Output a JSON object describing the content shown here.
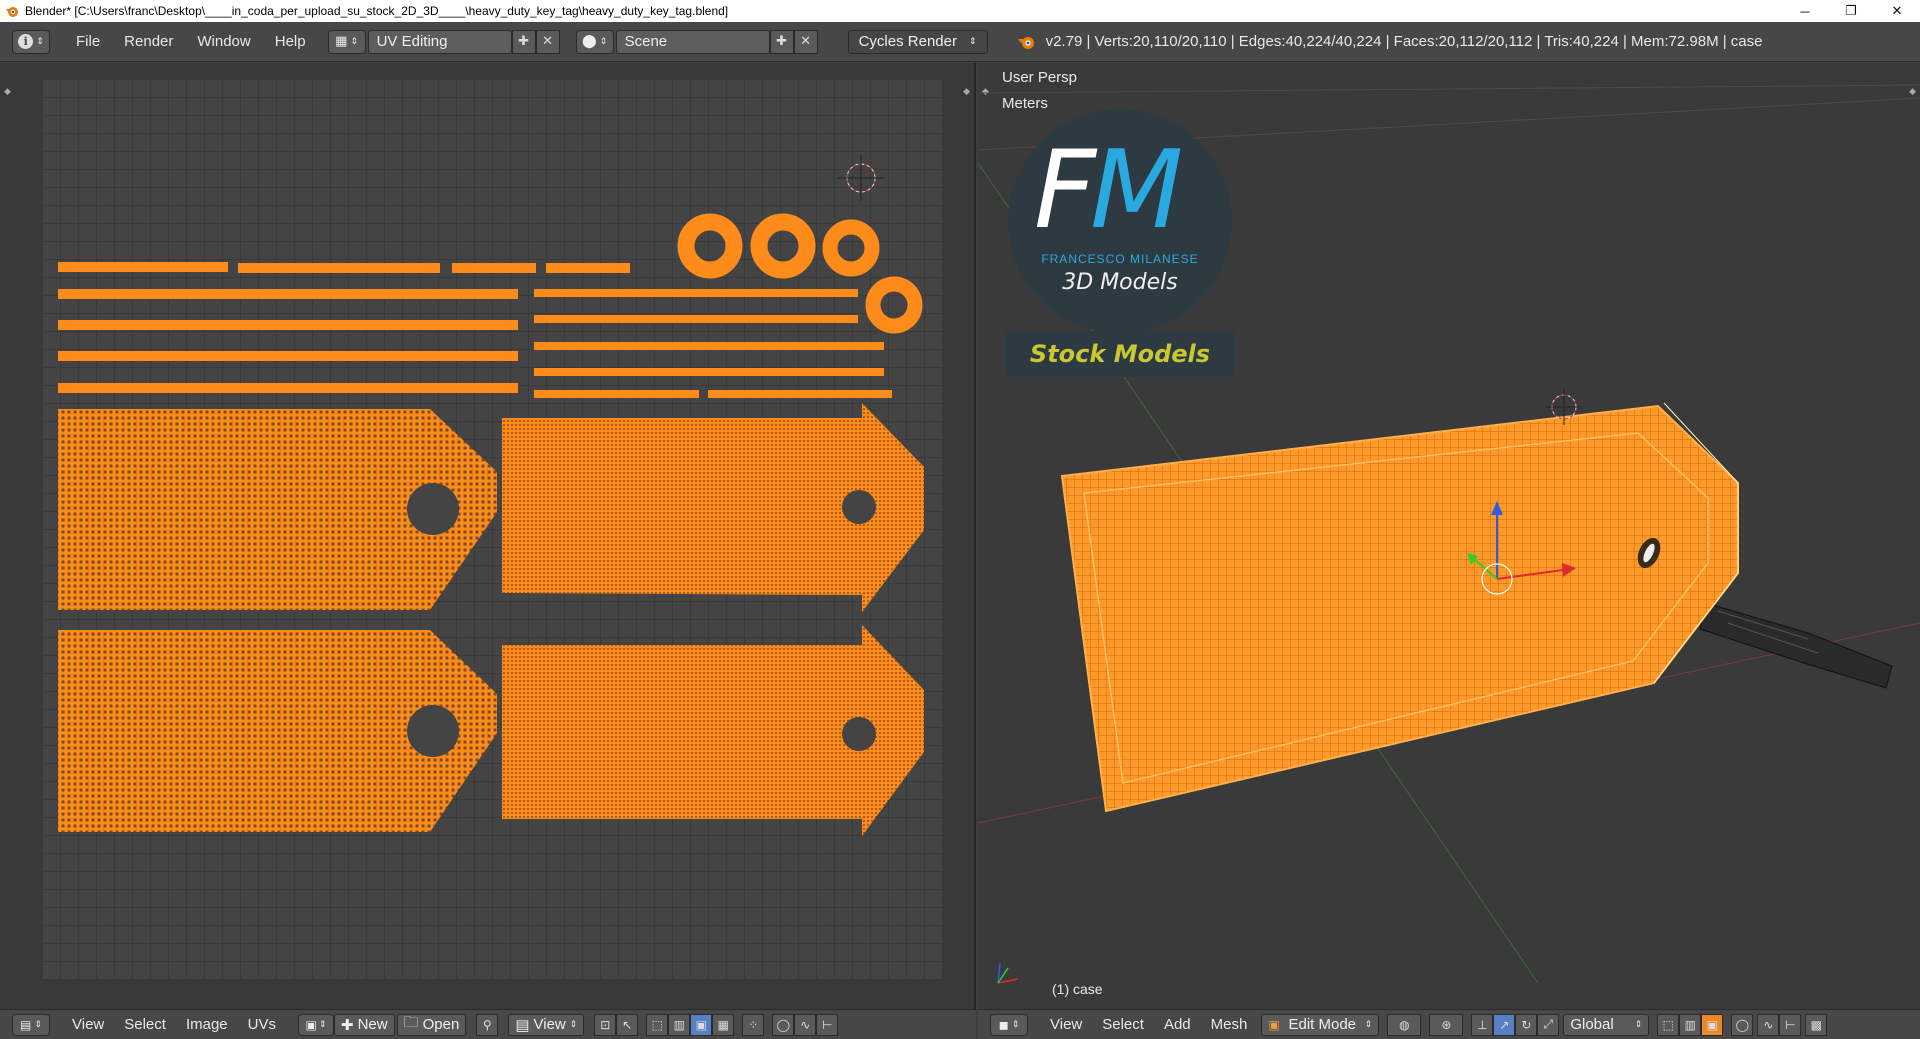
{
  "window": {
    "title": "Blender* [C:\\Users\\franc\\Desktop\\____in_coda_per_upload_su_stock_2D_3D____\\heavy_duty_key_tag\\heavy_duty_key_tag.blend]",
    "minimize": "─",
    "restore": "❐",
    "close": "✕"
  },
  "info_header": {
    "editor_icon": "info-icon",
    "menus": [
      "File",
      "Render",
      "Window",
      "Help"
    ],
    "screen_layout": "UV Editing",
    "scene": "Scene",
    "render_engine": "Cycles Render",
    "stats": "v2.79 | Verts:20,110/20,110 | Edges:40,224/40,224 | Faces:20,112/20,112 | Tris:40,224 | Mem:72.98M | case"
  },
  "uv_editor": {
    "menus": [
      "View",
      "Select",
      "Image",
      "UVs"
    ],
    "new_label": "New",
    "open_label": "Open",
    "view_label": "View"
  },
  "view3d": {
    "view_name": "User Persp",
    "units": "Meters",
    "object_label": "(1) case",
    "logo": {
      "initials_f": "F",
      "initials_m": "M",
      "brand_name": "FRANCESCO MILANESE",
      "brand_sub": "3D Models",
      "banner": "Stock Models"
    },
    "menus": [
      "View",
      "Select",
      "Add",
      "Mesh"
    ],
    "mode": "Edit Mode",
    "orientation": "Global"
  },
  "colors": {
    "mesh_orange": "#ff8c1a",
    "accent_blue": "#2aa9e0",
    "banner_yellow": "#c8c832"
  }
}
